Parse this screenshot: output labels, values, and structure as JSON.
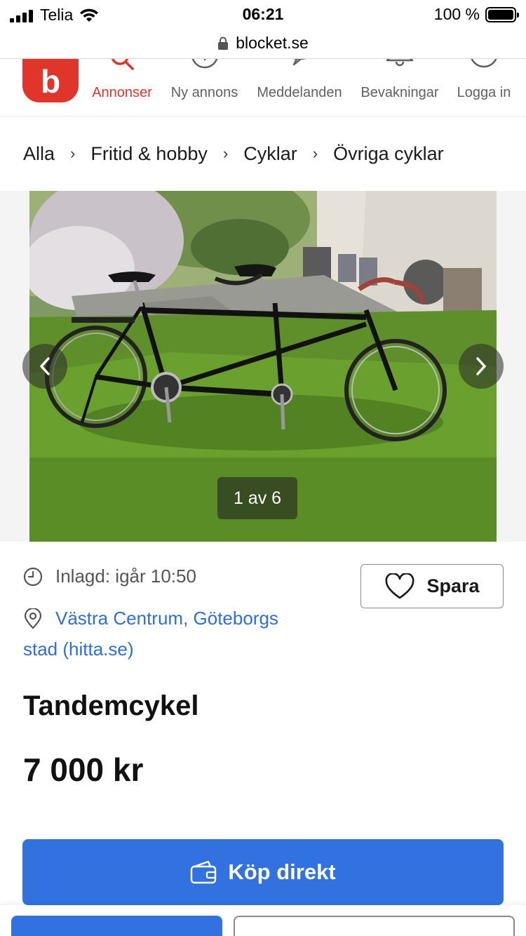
{
  "status_bar": {
    "carrier": "Telia",
    "time": "06:21",
    "battery_percent": "100 %",
    "signal_bars": 4
  },
  "browser": {
    "url": "blocket.se"
  },
  "nav": {
    "logo_letter": "b",
    "items": [
      {
        "label": "Annonser",
        "icon": "search-icon",
        "active": true
      },
      {
        "label": "Ny annons",
        "icon": "plus-circle-icon",
        "active": false
      },
      {
        "label": "Meddelanden",
        "icon": "chat-bubble-icon",
        "active": false
      },
      {
        "label": "Bevakningar",
        "icon": "bell-icon",
        "active": false
      },
      {
        "label": "Logga in",
        "icon": "user-circle-icon",
        "active": false
      }
    ]
  },
  "breadcrumb": {
    "items": [
      "Alla",
      "Fritid & hobby",
      "Cyklar",
      "Övriga cyklar"
    ],
    "separator": "›"
  },
  "gallery": {
    "counter": "1 av 6",
    "current": 1,
    "total": 6,
    "image_description": "tandem-bicycle-photo"
  },
  "listing": {
    "posted": "Inlagd: igår 10:50",
    "location_line1": "Västra Centrum, Göteborgs",
    "location_line2": "stad (hitta.se)",
    "save_label": "Spara",
    "title": "Tandemcykel",
    "price": "7 000 kr",
    "buy_label": "Köp direkt"
  },
  "colors": {
    "brand_red": "#e0352b",
    "primary_blue": "#3172e0",
    "link_blue": "#2f6ed6"
  }
}
